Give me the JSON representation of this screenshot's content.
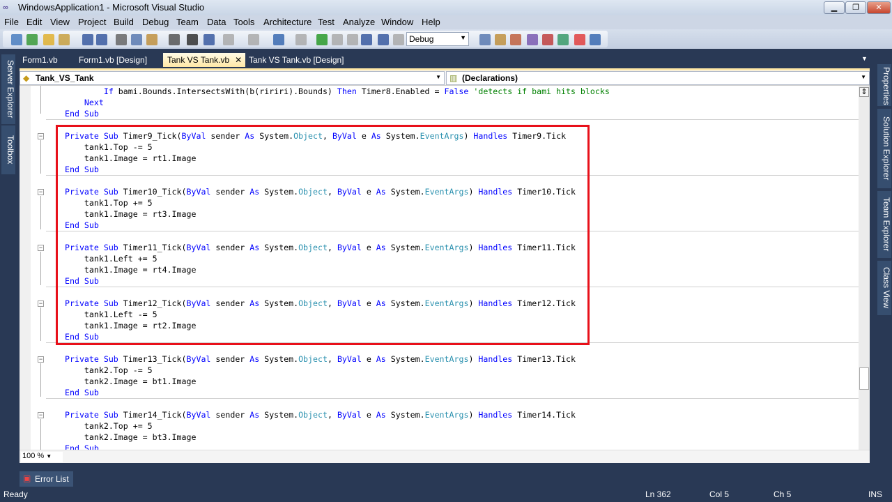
{
  "window": {
    "title": "WindowsApplication1 - Microsoft Visual Studio",
    "minimize": "▁",
    "restore": "❐",
    "close": "✕"
  },
  "menu": [
    "File",
    "Edit",
    "View",
    "Project",
    "Build",
    "Debug",
    "Team",
    "Data",
    "Tools",
    "Architecture",
    "Test",
    "Analyze",
    "Window",
    "Help"
  ],
  "toolbar": {
    "configuration": "Debug"
  },
  "tabs": [
    {
      "label": "Form1.vb"
    },
    {
      "label": "Form1.vb [Design]"
    },
    {
      "label": "Tank VS Tank.vb",
      "active": true,
      "close": "✕"
    },
    {
      "label": "Tank VS Tank.vb [Design]"
    }
  ],
  "left_dock": [
    "Server Explorer",
    "Toolbox"
  ],
  "right_dock": [
    "Properties",
    "Solution Explorer",
    "Team Explorer",
    "Class View"
  ],
  "nav": {
    "class_combo": "Tank_VS_Tank",
    "member_combo": "(Declarations)"
  },
  "code_lines": [
    [
      [
        "p",
        "        "
      ],
      [
        "k",
        "If"
      ],
      [
        "p",
        " bami.Bounds.IntersectsWith(b(ririri).Bounds) "
      ],
      [
        "k",
        "Then"
      ],
      [
        "p",
        " Timer8.Enabled = "
      ],
      [
        "k",
        "False"
      ],
      [
        "c",
        " 'detects if bami hits blocks"
      ]
    ],
    [
      [
        "p",
        "    "
      ],
      [
        "k",
        "Next"
      ]
    ],
    [
      [
        "k",
        "End Sub"
      ]
    ],
    [],
    [
      [
        "k",
        "Private Sub"
      ],
      [
        "p",
        " Timer9_Tick("
      ],
      [
        "k",
        "ByVal"
      ],
      [
        "p",
        " sender "
      ],
      [
        "k",
        "As"
      ],
      [
        "p",
        " System."
      ],
      [
        "t",
        "Object"
      ],
      [
        "p",
        ", "
      ],
      [
        "k",
        "ByVal"
      ],
      [
        "p",
        " e "
      ],
      [
        "k",
        "As"
      ],
      [
        "p",
        " System."
      ],
      [
        "t",
        "EventArgs"
      ],
      [
        "p",
        ") "
      ],
      [
        "k",
        "Handles"
      ],
      [
        "p",
        " Timer9.Tick"
      ]
    ],
    [
      [
        "p",
        "    tank1.Top -= 5"
      ]
    ],
    [
      [
        "p",
        "    tank1.Image = rt1.Image"
      ]
    ],
    [
      [
        "k",
        "End Sub"
      ]
    ],
    [],
    [
      [
        "k",
        "Private Sub"
      ],
      [
        "p",
        " Timer10_Tick("
      ],
      [
        "k",
        "ByVal"
      ],
      [
        "p",
        " sender "
      ],
      [
        "k",
        "As"
      ],
      [
        "p",
        " System."
      ],
      [
        "t",
        "Object"
      ],
      [
        "p",
        ", "
      ],
      [
        "k",
        "ByVal"
      ],
      [
        "p",
        " e "
      ],
      [
        "k",
        "As"
      ],
      [
        "p",
        " System."
      ],
      [
        "t",
        "EventArgs"
      ],
      [
        "p",
        ") "
      ],
      [
        "k",
        "Handles"
      ],
      [
        "p",
        " Timer10.Tick"
      ]
    ],
    [
      [
        "p",
        "    tank1.Top += 5"
      ]
    ],
    [
      [
        "p",
        "    tank1.Image = rt3.Image"
      ]
    ],
    [
      [
        "k",
        "End Sub"
      ]
    ],
    [],
    [
      [
        "k",
        "Private Sub"
      ],
      [
        "p",
        " Timer11_Tick("
      ],
      [
        "k",
        "ByVal"
      ],
      [
        "p",
        " sender "
      ],
      [
        "k",
        "As"
      ],
      [
        "p",
        " System."
      ],
      [
        "t",
        "Object"
      ],
      [
        "p",
        ", "
      ],
      [
        "k",
        "ByVal"
      ],
      [
        "p",
        " e "
      ],
      [
        "k",
        "As"
      ],
      [
        "p",
        " System."
      ],
      [
        "t",
        "EventArgs"
      ],
      [
        "p",
        ") "
      ],
      [
        "k",
        "Handles"
      ],
      [
        "p",
        " Timer11.Tick"
      ]
    ],
    [
      [
        "p",
        "    tank1.Left += 5"
      ]
    ],
    [
      [
        "p",
        "    tank1.Image = rt4.Image"
      ]
    ],
    [
      [
        "k",
        "End Sub"
      ]
    ],
    [],
    [
      [
        "k",
        "Private Sub"
      ],
      [
        "p",
        " Timer12_Tick("
      ],
      [
        "k",
        "ByVal"
      ],
      [
        "p",
        " sender "
      ],
      [
        "k",
        "As"
      ],
      [
        "p",
        " System."
      ],
      [
        "t",
        "Object"
      ],
      [
        "p",
        ", "
      ],
      [
        "k",
        "ByVal"
      ],
      [
        "p",
        " e "
      ],
      [
        "k",
        "As"
      ],
      [
        "p",
        " System."
      ],
      [
        "t",
        "EventArgs"
      ],
      [
        "p",
        ") "
      ],
      [
        "k",
        "Handles"
      ],
      [
        "p",
        " Timer12.Tick"
      ]
    ],
    [
      [
        "p",
        "    tank1.Left -= 5"
      ]
    ],
    [
      [
        "p",
        "    tank1.Image = rt2.Image"
      ]
    ],
    [
      [
        "k",
        "End Sub"
      ]
    ],
    [],
    [
      [
        "k",
        "Private Sub"
      ],
      [
        "p",
        " Timer13_Tick("
      ],
      [
        "k",
        "ByVal"
      ],
      [
        "p",
        " sender "
      ],
      [
        "k",
        "As"
      ],
      [
        "p",
        " System."
      ],
      [
        "t",
        "Object"
      ],
      [
        "p",
        ", "
      ],
      [
        "k",
        "ByVal"
      ],
      [
        "p",
        " e "
      ],
      [
        "k",
        "As"
      ],
      [
        "p",
        " System."
      ],
      [
        "t",
        "EventArgs"
      ],
      [
        "p",
        ") "
      ],
      [
        "k",
        "Handles"
      ],
      [
        "p",
        " Timer13.Tick"
      ]
    ],
    [
      [
        "p",
        "    tank2.Top -= 5"
      ]
    ],
    [
      [
        "p",
        "    tank2.Image = bt1.Image"
      ]
    ],
    [
      [
        "k",
        "End Sub"
      ]
    ],
    [],
    [
      [
        "k",
        "Private Sub"
      ],
      [
        "p",
        " Timer14_Tick("
      ],
      [
        "k",
        "ByVal"
      ],
      [
        "p",
        " sender "
      ],
      [
        "k",
        "As"
      ],
      [
        "p",
        " System."
      ],
      [
        "t",
        "Object"
      ],
      [
        "p",
        ", "
      ],
      [
        "k",
        "ByVal"
      ],
      [
        "p",
        " e "
      ],
      [
        "k",
        "As"
      ],
      [
        "p",
        " System."
      ],
      [
        "t",
        "EventArgs"
      ],
      [
        "p",
        ") "
      ],
      [
        "k",
        "Handles"
      ],
      [
        "p",
        " Timer14.Tick"
      ]
    ],
    [
      [
        "p",
        "    tank2.Top += 5"
      ]
    ],
    [
      [
        "p",
        "    tank2.Image = bt3.Image"
      ]
    ],
    [
      [
        "k",
        "End Sub"
      ]
    ]
  ],
  "editor": {
    "zoom": "100 %"
  },
  "error_list": "Error List",
  "status": {
    "state": "Ready",
    "line": "Ln 362",
    "col": "Col 5",
    "ch": "Ch 5",
    "mode": "INS"
  },
  "colors": {
    "keyword": "#0000ff",
    "type": "#2b91af",
    "comment": "#008000",
    "highlight_box": "#e8101a"
  }
}
